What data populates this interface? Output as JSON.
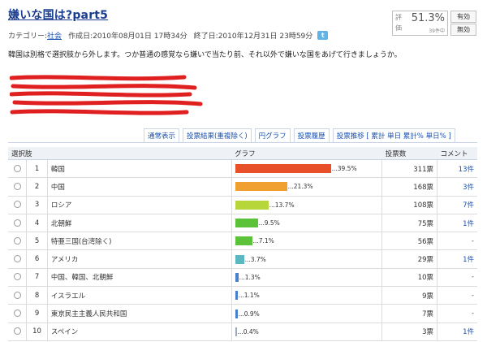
{
  "poll": {
    "title": "嫌いな国は?part5",
    "category_label": "カテゴリー:",
    "category": "社会",
    "created": "作成日:2010年08月01日 17時34分",
    "ends": "終了日:2010年12月31日 23時59分",
    "twitter": "t",
    "rating_label_top": "評",
    "rating_label_bottom": "価",
    "rating_pct": "51.3%",
    "rating_sub": "39件中",
    "vote_good": "有効",
    "vote_bad": "無効",
    "description": "韓国は別格で選択肢から外します。つか普通の感覚なら嫌いで当たり前、それ以外で嫌いな国をあげて行きましょうか。"
  },
  "tabs": [
    "通常表示",
    "投票結果(重複除く)",
    "円グラフ",
    "投票履歴",
    "投票推移 [ 累計 単日 累計% 単日% ]"
  ],
  "table": {
    "headers": {
      "choice": "選択肢",
      "graph": "グラフ",
      "votes": "投票数",
      "comment": "コメント"
    },
    "rows": [
      {
        "rank": "1",
        "name": "韓国",
        "pct": 39.5,
        "pct_label": "...39.5%",
        "color": "#e8502a",
        "votes": "311票",
        "comment": "13件"
      },
      {
        "rank": "2",
        "name": "中国",
        "pct": 21.3,
        "pct_label": "...21.3%",
        "color": "#f0a030",
        "votes": "168票",
        "comment": "3件"
      },
      {
        "rank": "3",
        "name": "ロシア",
        "pct": 13.7,
        "pct_label": "...13.7%",
        "color": "#b6d63a",
        "votes": "108票",
        "comment": "7件"
      },
      {
        "rank": "4",
        "name": "北朝鮮",
        "pct": 9.5,
        "pct_label": "...9.5%",
        "color": "#5cc23a",
        "votes": "75票",
        "comment": "1件"
      },
      {
        "rank": "5",
        "name": "特亜三国(台湾除く)",
        "pct": 7.1,
        "pct_label": "...7.1%",
        "color": "#5cc23a",
        "votes": "56票",
        "comment": "-"
      },
      {
        "rank": "6",
        "name": "アメリカ",
        "pct": 3.7,
        "pct_label": "...3.7%",
        "color": "#5cb8c0",
        "votes": "29票",
        "comment": "1件"
      },
      {
        "rank": "7",
        "name": "中国、韓国、北朝鮮",
        "pct": 1.3,
        "pct_label": "...1.3%",
        "color": "#4a7fd0",
        "votes": "10票",
        "comment": "-"
      },
      {
        "rank": "8",
        "name": "イスラエル",
        "pct": 1.1,
        "pct_label": "...1.1%",
        "color": "#4a7fd0",
        "votes": "9票",
        "comment": "-"
      },
      {
        "rank": "9",
        "name": "東京民主主義人民共和国",
        "pct": 0.9,
        "pct_label": "...0.9%",
        "color": "#4a7fd0",
        "votes": "7票",
        "comment": "-"
      },
      {
        "rank": "10",
        "name": "スペイン",
        "pct": 0.4,
        "pct_label": "...0.4%",
        "color": "#9aa8c8",
        "votes": "3票",
        "comment": "1件"
      }
    ]
  }
}
